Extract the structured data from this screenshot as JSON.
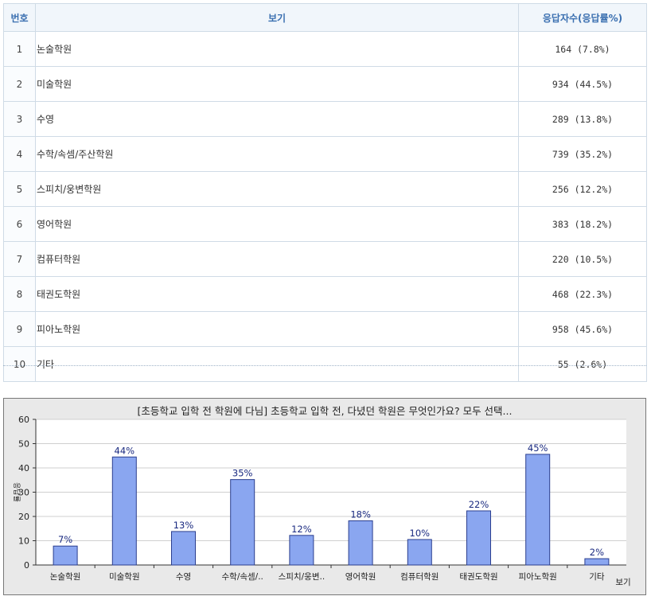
{
  "table": {
    "headers": {
      "num": "번호",
      "option": "보기",
      "result": "응답자수(응답률%)"
    },
    "rows": [
      {
        "num": "1",
        "option": "논술학원",
        "result": "164 (7.8%)"
      },
      {
        "num": "2",
        "option": "미술학원",
        "result": "934 (44.5%)"
      },
      {
        "num": "3",
        "option": "수영",
        "result": "289 (13.8%)"
      },
      {
        "num": "4",
        "option": "수학/속셈/주산학원",
        "result": "739 (35.2%)"
      },
      {
        "num": "5",
        "option": "스피치/웅변학원",
        "result": "256 (12.2%)"
      },
      {
        "num": "6",
        "option": "영어학원",
        "result": "383 (18.2%)"
      },
      {
        "num": "7",
        "option": "컴퓨터학원",
        "result": "220 (10.5%)"
      },
      {
        "num": "8",
        "option": "태권도학원",
        "result": "468 (22.3%)"
      },
      {
        "num": "9",
        "option": "피아노학원",
        "result": "958 (45.6%)"
      },
      {
        "num": "10",
        "option": "기타",
        "result": "55 (2.6%)"
      }
    ]
  },
  "colors": {
    "bar": "#8aa6f0",
    "bar_border": "#2b3f8f",
    "label": "#1a2a80",
    "plot_bg": "#ffffff",
    "panel_bg": "#e9e9e9"
  },
  "chart_data": {
    "type": "bar",
    "title": "[초등학교 입학 전 학원에 다님] 초등학교 입학 전, 다녔던 학원은 무엇인가요? 모두 선택...",
    "categories": [
      "논술학원",
      "미술학원",
      "수영",
      "수학/속셈/..",
      "스피치/웅변..",
      "영어학원",
      "컴퓨터학원",
      "태권도학원",
      "피아노학원",
      "기타"
    ],
    "values": [
      7.8,
      44.5,
      13.8,
      35.2,
      12.2,
      18.2,
      10.5,
      22.3,
      45.6,
      2.6
    ],
    "data_labels": [
      "7%",
      "44%",
      "13%",
      "35%",
      "12%",
      "18%",
      "10%",
      "22%",
      "45%",
      "2%"
    ],
    "xlabel": "보기",
    "ylabel": "응답률",
    "ylim": [
      0,
      60
    ],
    "yticks": [
      0,
      10,
      20,
      30,
      40,
      50,
      60
    ],
    "grid": true
  }
}
